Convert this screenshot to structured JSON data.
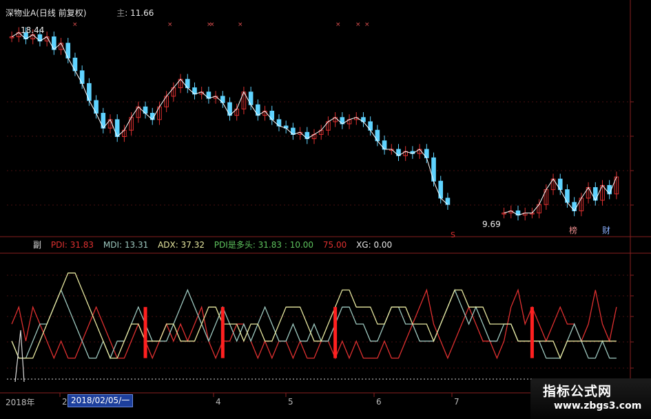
{
  "header": {
    "security": "深物业A(日线 前复权)",
    "ma_label": "主",
    "ma_value": ": 11.66"
  },
  "indicator_header": {
    "tag": "副",
    "items": [
      {
        "label": "PDI: 31.83",
        "color": "#e03030"
      },
      {
        "label": "MDI: 13.31",
        "color": "#9ec9c0"
      },
      {
        "label": "ADX: 37.32",
        "color": "#e8e8a0"
      },
      {
        "label": "PDI是多头: 31.83 : 10.00",
        "color": "#5ec45e"
      },
      {
        "label": "75.00",
        "color": "#e03030"
      },
      {
        "label": "XG: 0.00",
        "color": "#e8e8e8"
      }
    ]
  },
  "price_annotations": {
    "high": "18.44",
    "low": "9.69",
    "mark_s": "S",
    "mark_bang": "榜",
    "mark_cai": "财"
  },
  "xaxis": {
    "year_label": "2018年",
    "date_box": "2018/02/05/一",
    "months": [
      "2",
      "4",
      "5",
      "6",
      "7"
    ]
  },
  "watermark": {
    "cn": "指标公式网",
    "url": "www.zbgs3.com"
  },
  "colors": {
    "up": "#e03030",
    "down": "#5fd3ff",
    "pdi": "#e03030",
    "mdi": "#9ec9c0",
    "adx": "#e8e8a0",
    "signal": "#ff2020",
    "grid": "#8a2020"
  },
  "chart_data": {
    "type": "line",
    "title": "深物业A(日线 前复权)",
    "price_series": {
      "name": "close",
      "y": [
        18.2,
        18.4,
        18.1,
        18.3,
        18.0,
        18.2,
        17.6,
        17.9,
        17.2,
        16.6,
        16.0,
        15.2,
        14.6,
        13.9,
        14.3,
        13.5,
        13.8,
        14.4,
        14.9,
        14.6,
        14.3,
        14.9,
        15.4,
        15.8,
        16.2,
        15.8,
        15.5,
        15.6,
        15.3,
        15.4,
        15.1,
        14.5,
        14.8,
        15.6,
        15.0,
        14.5,
        14.7,
        14.3,
        14.0,
        13.9,
        13.6,
        13.7,
        13.4,
        13.6,
        13.8,
        14.2,
        14.4,
        14.1,
        14.3,
        14.4,
        14.2,
        13.8,
        13.3,
        12.9,
        12.9,
        12.6,
        12.8,
        12.7,
        12.9,
        12.5,
        11.4,
        10.6,
        10.3,
        null,
        null,
        null,
        null,
        null,
        null,
        null,
        9.9,
        10.0,
        9.8,
        9.9,
        9.9,
        10.3,
        11.0,
        11.5,
        11.0,
        10.4,
        10.0,
        10.6,
        11.1,
        10.5,
        11.2,
        10.8,
        11.6
      ]
    },
    "indicator_series": [
      {
        "name": "PDI",
        "y": [
          4,
          5,
          3,
          5,
          4,
          3,
          2,
          3,
          2,
          2,
          3,
          4,
          5,
          4,
          3,
          2,
          2,
          3,
          4,
          3,
          2,
          3,
          4,
          3,
          4,
          3,
          4,
          5,
          3,
          2,
          3,
          3,
          4,
          4,
          3,
          2,
          3,
          2,
          3,
          3,
          2,
          3,
          2,
          2,
          3,
          3,
          2,
          3,
          2,
          3,
          2,
          2,
          2,
          3,
          2,
          2,
          3,
          4,
          5,
          6,
          4,
          3,
          2,
          3,
          4,
          5,
          4,
          3,
          3,
          2,
          3,
          5,
          6,
          4,
          5,
          4,
          3,
          4,
          5,
          4,
          4,
          3,
          4,
          6,
          4,
          3,
          5
        ]
      },
      {
        "name": "MDI",
        "y": [
          3,
          2,
          2,
          3,
          4,
          4,
          5,
          6,
          5,
          4,
          3,
          2,
          2,
          3,
          2,
          3,
          3,
          4,
          5,
          4,
          3,
          3,
          3,
          4,
          5,
          6,
          5,
          4,
          3,
          4,
          5,
          4,
          3,
          4,
          3,
          4,
          5,
          4,
          3,
          3,
          4,
          3,
          3,
          4,
          3,
          3,
          4,
          5,
          5,
          4,
          4,
          3,
          3,
          4,
          5,
          5,
          4,
          4,
          3,
          3,
          3,
          4,
          5,
          6,
          5,
          4,
          5,
          4,
          3,
          3,
          4,
          4,
          3,
          3,
          3,
          3,
          2,
          2,
          2,
          3,
          4,
          3,
          2,
          2,
          3,
          2,
          2
        ]
      },
      {
        "name": "ADX",
        "y": [
          3,
          2,
          2,
          2,
          3,
          4,
          5,
          6,
          7,
          7,
          6,
          5,
          4,
          3,
          2,
          2,
          3,
          4,
          4,
          3,
          3,
          3,
          4,
          4,
          3,
          3,
          3,
          4,
          5,
          5,
          4,
          4,
          4,
          3,
          4,
          4,
          3,
          3,
          4,
          5,
          5,
          5,
          4,
          3,
          3,
          4,
          5,
          6,
          6,
          5,
          5,
          5,
          4,
          4,
          5,
          5,
          5,
          4,
          4,
          4,
          3,
          4,
          5,
          6,
          6,
          5,
          5,
          5,
          4,
          4,
          4,
          4,
          3,
          3,
          3,
          3,
          3,
          3,
          2,
          3,
          3,
          3,
          3,
          3,
          3,
          3,
          3
        ]
      }
    ],
    "signals_x": [
      19,
      30,
      46,
      74
    ],
    "ylim_indicator": [
      0,
      8
    ]
  }
}
